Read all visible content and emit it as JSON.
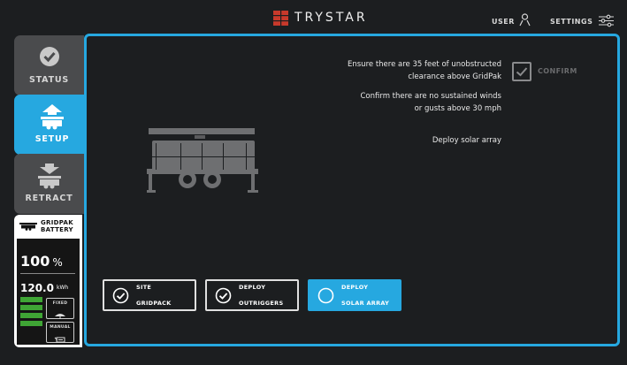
{
  "header": {
    "brand": "TRYSTAR",
    "user_label": "USER",
    "settings_label": "SETTINGS"
  },
  "sidebar": {
    "tabs": [
      {
        "label": "STATUS",
        "icon": "check-circle-icon",
        "active": false
      },
      {
        "label": "SETUP",
        "icon": "deploy-up-icon",
        "active": true
      },
      {
        "label": "RETRACT",
        "icon": "retract-down-icon",
        "active": false
      }
    ]
  },
  "battery": {
    "title_line1": "GRIDPAK",
    "title_line2": "BATTERY",
    "percent": "100",
    "percent_unit": "%",
    "energy": "120.0",
    "energy_unit": "kWh",
    "level_bars": 4,
    "modes": [
      {
        "label": "FIXED",
        "icon": "umbrella-icon"
      },
      {
        "label": "MANUAL",
        "icon": "manual-control-icon"
      }
    ]
  },
  "main": {
    "instructions": [
      {
        "line1": "Ensure there are 35 feet of unobstructed",
        "line2": "clearance above GridPak"
      },
      {
        "line1": "Confirm there are no sustained winds",
        "line2": "or gusts above 30 mph"
      },
      {
        "line1": "Deploy solar array",
        "line2": ""
      }
    ],
    "confirm_label": "CONFIRM",
    "steps": [
      {
        "line1": "SITE",
        "line2": "GRIDPACK",
        "state": "done"
      },
      {
        "line1": "DEPLOY",
        "line2": "OUTRIGGERS",
        "state": "done"
      },
      {
        "line1": "DEPLOY",
        "line2": "SOLAR ARRAY",
        "state": "active"
      }
    ]
  },
  "colors": {
    "accent": "#26a8e0",
    "background": "#1c1e20",
    "tab_inactive": "#4a4b4d",
    "battery_green": "#3fa535",
    "brand_red": "#c8392b"
  }
}
